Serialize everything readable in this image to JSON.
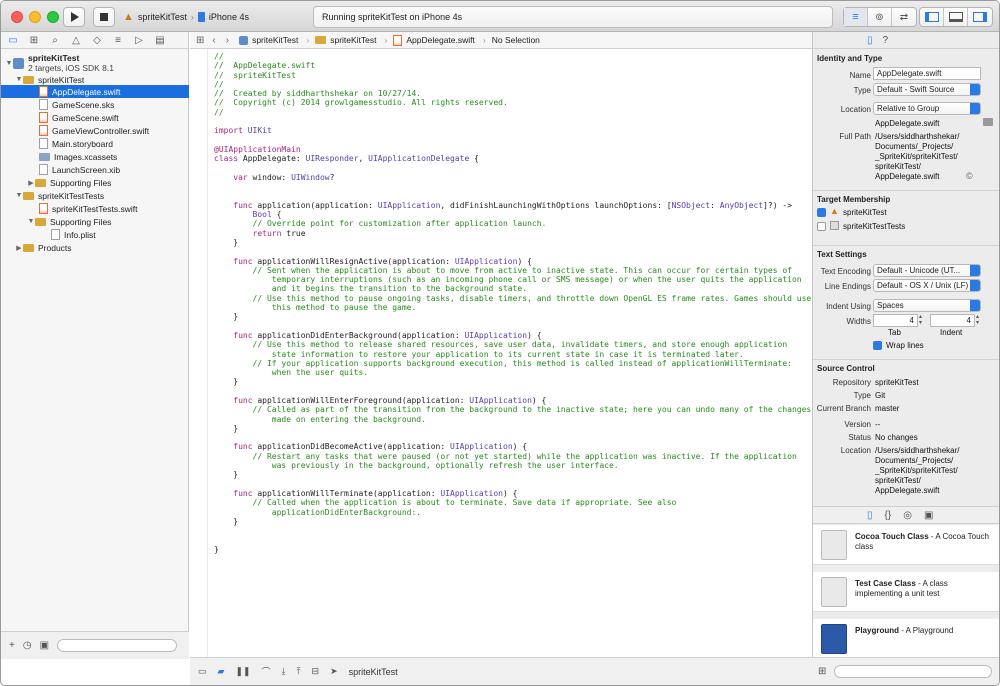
{
  "toolbar": {
    "scheme": "spriteKitTest",
    "device": "iPhone 4s",
    "activity": "Running spriteKitTest on iPhone 4s"
  },
  "navigator": {
    "items": [
      {
        "label": "spriteKitTest",
        "sub": "2 targets, iOS SDK 8.1",
        "type": "proj"
      },
      {
        "label": "spriteKitTest",
        "type": "folder"
      },
      {
        "label": "AppDelegate.swift",
        "type": "swift",
        "selected": true
      },
      {
        "label": "GameScene.sks",
        "type": "file"
      },
      {
        "label": "GameScene.swift",
        "type": "swift"
      },
      {
        "label": "GameViewController.swift",
        "type": "swift"
      },
      {
        "label": "Main.storyboard",
        "type": "file"
      },
      {
        "label": "Images.xcassets",
        "type": "folder"
      },
      {
        "label": "LaunchScreen.xib",
        "type": "file"
      },
      {
        "label": "Supporting Files",
        "type": "folder"
      },
      {
        "label": "spriteKitTestTests",
        "type": "folder"
      },
      {
        "label": "spriteKitTestTests.swift",
        "type": "swift"
      },
      {
        "label": "Supporting Files",
        "type": "folder"
      },
      {
        "label": "Info.plist",
        "type": "file"
      },
      {
        "label": "Products",
        "type": "folder"
      }
    ]
  },
  "jumpbar": {
    "crumbs": [
      "spriteKitTest",
      "spriteKitTest",
      "AppDelegate.swift",
      "No Selection"
    ]
  },
  "code": {
    "lines": [
      "//",
      "//  AppDelegate.swift",
      "//  spriteKitTest",
      "//",
      "//  Created by siddharthshekar on 10/27/14.",
      "//  Copyright (c) 2014 growlgamesstudio. All rights reserved.",
      "//",
      "",
      "import UIKit",
      "",
      "@UIApplicationMain",
      "class AppDelegate: UIResponder, UIApplicationDelegate {",
      "",
      "    var window: UIWindow?",
      "",
      "",
      "    func application(application: UIApplication, didFinishLaunchingWithOptions launchOptions: [NSObject: AnyObject]?) ->",
      "        Bool {",
      "        // Override point for customization after application launch.",
      "        return true",
      "    }",
      "",
      "    func applicationWillResignActive(application: UIApplication) {",
      "        // Sent when the application is about to move from active to inactive state. This can occur for certain types of",
      "            temporary interruptions (such as an incoming phone call or SMS message) or when the user quits the application",
      "            and it begins the transition to the background state.",
      "        // Use this method to pause ongoing tasks, disable timers, and throttle down OpenGL ES frame rates. Games should use",
      "            this method to pause the game.",
      "    }",
      "",
      "    func applicationDidEnterBackground(application: UIApplication) {",
      "        // Use this method to release shared resources, save user data, invalidate timers, and store enough application",
      "            state information to restore your application to its current state in case it is terminated later.",
      "        // If your application supports background execution, this method is called instead of applicationWillTerminate:",
      "            when the user quits.",
      "    }",
      "",
      "    func applicationWillEnterForeground(application: UIApplication) {",
      "        // Called as part of the transition from the background to the inactive state; here you can undo many of the changes",
      "            made on entering the background.",
      "    }",
      "",
      "    func applicationDidBecomeActive(application: UIApplication) {",
      "        // Restart any tasks that were paused (or not yet started) while the application was inactive. If the application",
      "            was previously in the background, optionally refresh the user interface.",
      "    }",
      "",
      "    func applicationWillTerminate(application: UIApplication) {",
      "        // Called when the application is about to terminate. Save data if appropriate. See also",
      "            applicationDidEnterBackground:.",
      "    }",
      "",
      "",
      "}"
    ]
  },
  "editor_bottom": {
    "target": "spriteKitTest"
  },
  "inspector": {
    "identity": {
      "title": "Identity and Type",
      "name_label": "Name",
      "name": "AppDelegate.swift",
      "type_label": "Type",
      "type": "Default - Swift Source",
      "location_label": "Location",
      "location": "Relative to Group",
      "location_file": "AppDelegate.swift",
      "fullpath_label": "Full Path",
      "fullpath": [
        "/Users/siddharthshekar/",
        "Documents/_Projects/",
        "_SpriteKit/spriteKitTest/",
        "spriteKitTest/",
        "AppDelegate.swift"
      ]
    },
    "membership": {
      "title": "Target Membership",
      "targets": [
        {
          "name": "spriteKitTest",
          "checked": true
        },
        {
          "name": "spriteKitTestTests",
          "checked": false
        }
      ]
    },
    "text": {
      "title": "Text Settings",
      "encoding_label": "Text Encoding",
      "encoding": "Default - Unicode (UT...",
      "endings_label": "Line Endings",
      "endings": "Default - OS X / Unix (LF)",
      "indent_label": "Indent Using",
      "indent": "Spaces",
      "widths_label": "Widths",
      "tab": "4",
      "indent_width": "4",
      "tab_label": "Tab",
      "indent_sub_label": "Indent",
      "wrap_label": "Wrap lines"
    },
    "source": {
      "title": "Source Control",
      "repo_label": "Repository",
      "repo": "spriteKitTest",
      "type_label": "Type",
      "type": "Git",
      "branch_label": "Current Branch",
      "branch": "master",
      "version_label": "Version",
      "version": "--",
      "status_label": "Status",
      "status": "No changes",
      "location_label": "Location",
      "location": [
        "/Users/siddharthshekar/",
        "Documents/_Projects/",
        "_SpriteKit/spriteKitTest/",
        "spriteKitTest/",
        "AppDelegate.swift"
      ]
    },
    "library": [
      {
        "title": "Cocoa Touch Class",
        "desc": " - A Cocoa Touch class"
      },
      {
        "title": "Test Case Class",
        "desc": " - A class implementing a unit test"
      },
      {
        "title": "Playground",
        "desc": " - A Playground"
      }
    ]
  }
}
